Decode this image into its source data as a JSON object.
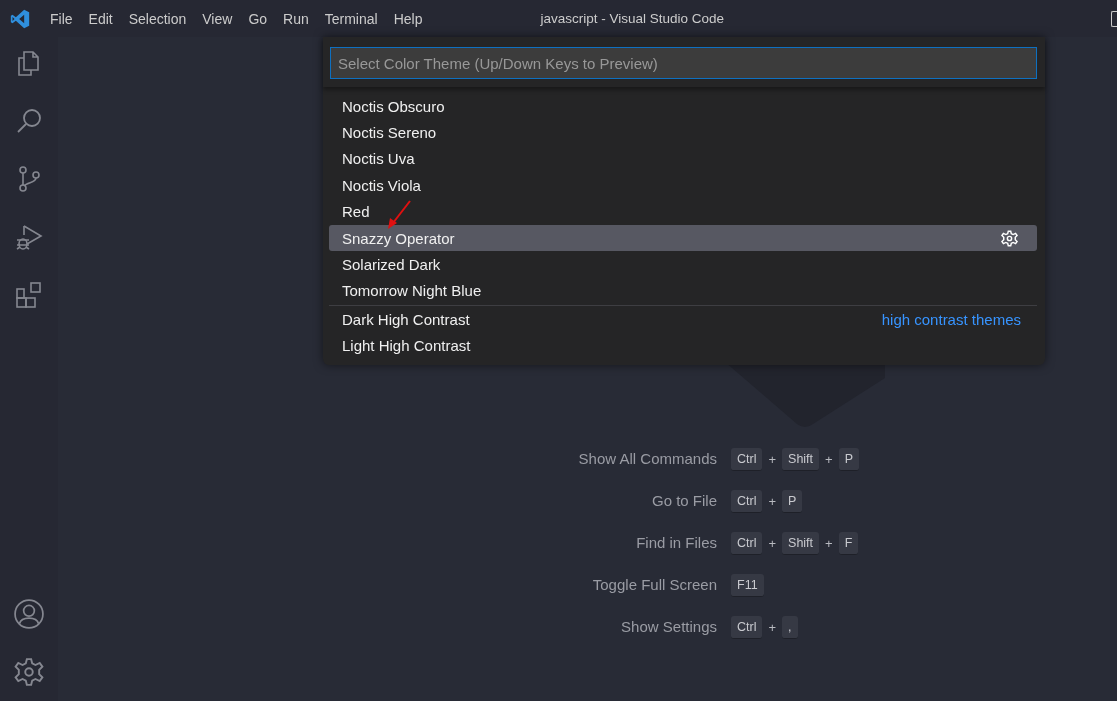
{
  "menu": [
    "File",
    "Edit",
    "Selection",
    "View",
    "Go",
    "Run",
    "Terminal",
    "Help"
  ],
  "window": {
    "title": "javascript - Visual Studio Code"
  },
  "quick_pick": {
    "placeholder": "Select Color Theme (Up/Down Keys to Preview)",
    "groups": [
      {
        "items": [
          {
            "label": "Noctis Obscuro",
            "selected": false
          },
          {
            "label": "Noctis Sereno",
            "selected": false
          },
          {
            "label": "Noctis Uva",
            "selected": false
          },
          {
            "label": "Noctis Viola",
            "selected": false
          },
          {
            "label": "Red",
            "selected": false
          },
          {
            "label": "Snazzy Operator",
            "selected": true
          },
          {
            "label": "Solarized Dark",
            "selected": false
          },
          {
            "label": "Tomorrow Night Blue",
            "selected": false
          }
        ]
      },
      {
        "label": "high contrast themes",
        "items": [
          {
            "label": "Dark High Contrast",
            "selected": false
          },
          {
            "label": "Light High Contrast",
            "selected": false
          }
        ]
      }
    ]
  },
  "shortcuts": [
    {
      "label": "Show All Commands",
      "keys": [
        {
          "kind": "key",
          "text": "Ctrl"
        },
        {
          "kind": "plus",
          "text": "+"
        },
        {
          "kind": "key",
          "text": "Shift"
        },
        {
          "kind": "plus",
          "text": "+"
        },
        {
          "kind": "key",
          "text": "P"
        }
      ]
    },
    {
      "label": "Go to File",
      "keys": [
        {
          "kind": "key",
          "text": "Ctrl"
        },
        {
          "kind": "plus",
          "text": "+"
        },
        {
          "kind": "key",
          "text": "P"
        }
      ]
    },
    {
      "label": "Find in Files",
      "keys": [
        {
          "kind": "key",
          "text": "Ctrl"
        },
        {
          "kind": "plus",
          "text": "+"
        },
        {
          "kind": "key",
          "text": "Shift"
        },
        {
          "kind": "plus",
          "text": "+"
        },
        {
          "kind": "key",
          "text": "F"
        }
      ]
    },
    {
      "label": "Toggle Full Screen",
      "keys": [
        {
          "kind": "key",
          "text": "F11"
        }
      ]
    },
    {
      "label": "Show Settings",
      "keys": [
        {
          "kind": "key",
          "text": "Ctrl"
        },
        {
          "kind": "plus",
          "text": "+"
        },
        {
          "kind": "key",
          "text": ","
        }
      ]
    }
  ]
}
